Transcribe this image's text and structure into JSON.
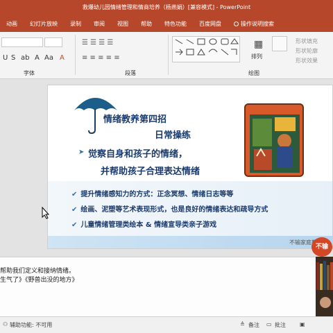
{
  "window": {
    "title": "救爆幼儿园情绪管理和情商培养（杨燕娟）[兼容模式] - PowerPoint"
  },
  "menu": {
    "tabs": [
      "动画",
      "幻灯片放映",
      "录制",
      "审阅",
      "视图",
      "帮助",
      "特色功能",
      "百度网盘"
    ],
    "tell_me": "操作说明搜索"
  },
  "ribbon": {
    "font_group": "字体",
    "paragraph_group": "段落",
    "drawing_group": "绘图",
    "arrange_label": "排列",
    "quick_styles_label": "快速样式",
    "shape_fill": "形状填充",
    "shape_outline": "形状轮廓",
    "shape_effects": "形状效果"
  },
  "slide": {
    "title": "情绪教养第四招",
    "subtitle": "日常操练",
    "main_line1": "觉察自身和孩子的情绪，",
    "main_line2": "并帮助孩子合理表达情绪",
    "bullets": [
      "提升情绪感知力的方式：正念冥想、情绪日志等等",
      "绘画、泥塑等艺术表现形式，也是良好的情绪表达和疏导方式",
      "儿童情绪管理类绘本 & 情绪宣导类亲子游戏"
    ],
    "footer": "不输家庭教育",
    "stamp": "不输"
  },
  "notes": {
    "line1": "帮助我们定义和接纳情绪。",
    "line2": "生气了》《野兽出没的地方》"
  },
  "status": {
    "accessibility": "辅助功能: 不可用",
    "notes_btn": "备注",
    "comments_btn": "批注"
  },
  "colors": {
    "accent": "#b7472a",
    "slide_text": "#1a3b6e",
    "highlight": "#2d6fb3"
  }
}
